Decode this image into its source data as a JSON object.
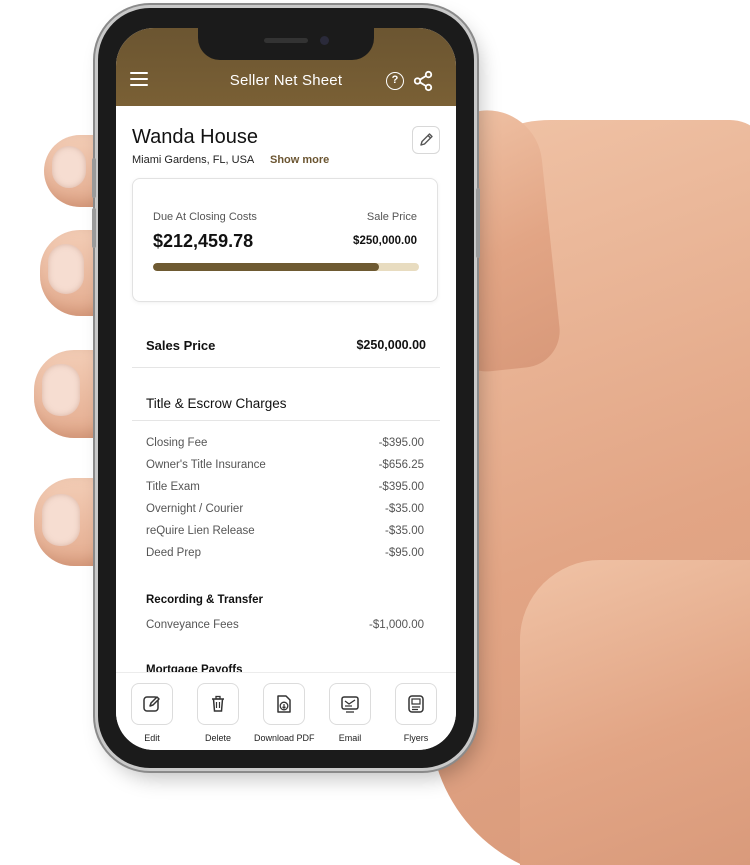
{
  "header": {
    "title": "Seller Net Sheet",
    "help_label": "?"
  },
  "property": {
    "name": "Wanda House",
    "location": "Miami Gardens, FL, USA",
    "show_more": "Show more"
  },
  "summary": {
    "due_label": "Due At Closing Costs",
    "due_amount": "$212,459.78",
    "price_label": "Sale Price",
    "price_amount": "$250,000.00",
    "progress_fraction": 0.85,
    "colors": {
      "fill": "#6e5a32",
      "track": "#e8dcc0"
    }
  },
  "sales_price": {
    "label": "Sales Price",
    "value": "$250,000.00"
  },
  "title_escrow": {
    "title": "Title & Escrow Charges",
    "items": [
      {
        "label": "Closing Fee",
        "value": "-$395.00"
      },
      {
        "label": "Owner's Title Insurance",
        "value": "-$656.25"
      },
      {
        "label": "Title Exam",
        "value": "-$395.00"
      },
      {
        "label": "Overnight / Courier",
        "value": "-$35.00"
      },
      {
        "label": "reQuire Lien Release",
        "value": "-$35.00"
      },
      {
        "label": "Deed Prep",
        "value": "-$95.00"
      }
    ]
  },
  "recording": {
    "title": "Recording & Transfer",
    "items": [
      {
        "label": "Conveyance Fees",
        "value": "-$1,000.00"
      }
    ]
  },
  "mortgage": {
    "title": "Mortgage Payoffs"
  },
  "toolbar": {
    "edit": "Edit",
    "delete": "Delete",
    "download": "Download PDF",
    "email": "Email",
    "flyers": "Flyers"
  },
  "icons": {
    "menu": "menu-icon",
    "help": "help-icon",
    "share": "share-icon",
    "pencil": "pencil-icon",
    "edit": "edit-icon",
    "trash": "trash-icon",
    "download": "download-pdf-icon",
    "email": "email-icon",
    "flyers": "flyers-icon"
  },
  "colors": {
    "brand": "#6b5531",
    "accent_text": "#6b5531"
  }
}
